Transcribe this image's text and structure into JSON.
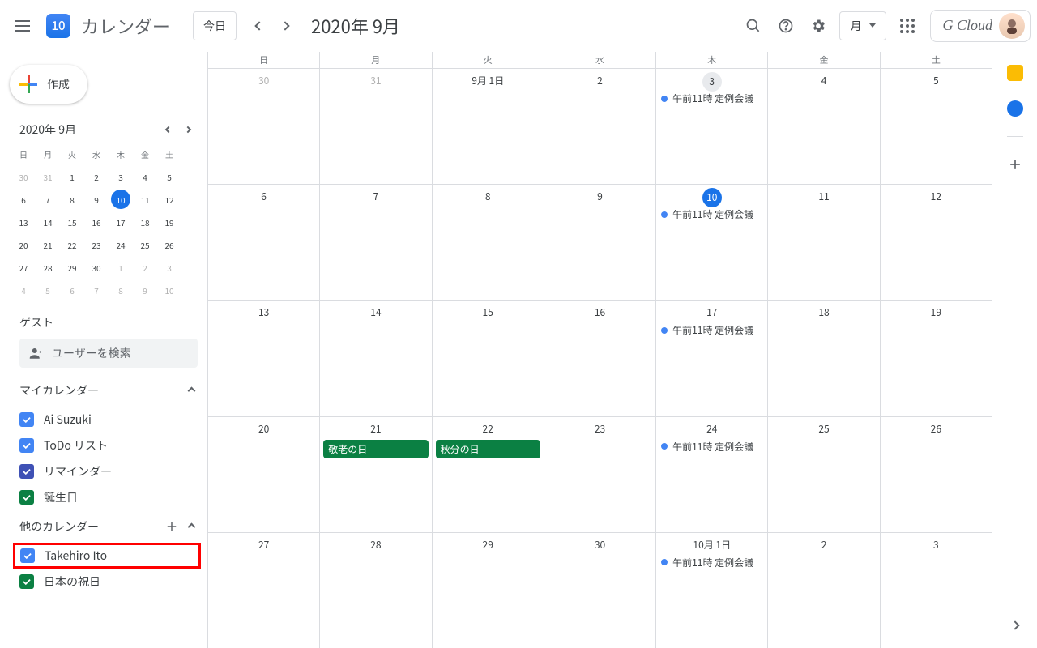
{
  "header": {
    "app_title": "カレンダー",
    "logo_day": "10",
    "today_btn": "今日",
    "date_title": "2020年 9月",
    "view_label": "月",
    "brand": "G Cloud"
  },
  "sidebar": {
    "create": "作成",
    "mini_title": "2020年 9月",
    "dow": [
      "日",
      "月",
      "火",
      "水",
      "木",
      "金",
      "土"
    ],
    "weeks": [
      [
        {
          "n": "30",
          "dim": true
        },
        {
          "n": "31",
          "dim": true
        },
        {
          "n": "1"
        },
        {
          "n": "2"
        },
        {
          "n": "3"
        },
        {
          "n": "4"
        },
        {
          "n": "5"
        }
      ],
      [
        {
          "n": "6"
        },
        {
          "n": "7"
        },
        {
          "n": "8"
        },
        {
          "n": "9"
        },
        {
          "n": "10",
          "today": true
        },
        {
          "n": "11"
        },
        {
          "n": "12"
        }
      ],
      [
        {
          "n": "13"
        },
        {
          "n": "14"
        },
        {
          "n": "15"
        },
        {
          "n": "16"
        },
        {
          "n": "17"
        },
        {
          "n": "18"
        },
        {
          "n": "19"
        }
      ],
      [
        {
          "n": "20"
        },
        {
          "n": "21"
        },
        {
          "n": "22"
        },
        {
          "n": "23"
        },
        {
          "n": "24"
        },
        {
          "n": "25"
        },
        {
          "n": "26"
        }
      ],
      [
        {
          "n": "27"
        },
        {
          "n": "28"
        },
        {
          "n": "29"
        },
        {
          "n": "30"
        },
        {
          "n": "1",
          "dim": true
        },
        {
          "n": "2",
          "dim": true
        },
        {
          "n": "3",
          "dim": true
        }
      ],
      [
        {
          "n": "4",
          "dim": true
        },
        {
          "n": "5",
          "dim": true
        },
        {
          "n": "6",
          "dim": true
        },
        {
          "n": "7",
          "dim": true
        },
        {
          "n": "8",
          "dim": true
        },
        {
          "n": "9",
          "dim": true
        },
        {
          "n": "10",
          "dim": true
        }
      ]
    ],
    "guest_label": "ゲスト",
    "search_placeholder": "ユーザーを検索",
    "my_cal": "マイカレンダー",
    "other_cal": "他のカレンダー",
    "my_items": [
      {
        "label": "Ai Suzuki",
        "color": "#4285f4"
      },
      {
        "label": "ToDo リスト",
        "color": "#4285f4"
      },
      {
        "label": "リマインダー",
        "color": "#3f51b5"
      },
      {
        "label": "誕生日",
        "color": "#0b8043"
      }
    ],
    "other_items": [
      {
        "label": "Takehiro Ito",
        "color": "#4285f4",
        "hl": true
      },
      {
        "label": "日本の祝日",
        "color": "#0b8043"
      }
    ]
  },
  "grid": {
    "dow": [
      "日",
      "月",
      "火",
      "水",
      "木",
      "金",
      "土"
    ],
    "weeks": [
      [
        {
          "n": "30",
          "dim": true
        },
        {
          "n": "31",
          "dim": true
        },
        {
          "n": "9月 1日"
        },
        {
          "n": "2"
        },
        {
          "n": "3",
          "past": true,
          "ev": [
            {
              "time": "午前11時",
              "title": "定例会議",
              "color": "#4285f4"
            }
          ]
        },
        {
          "n": "4"
        },
        {
          "n": "5"
        }
      ],
      [
        {
          "n": "6"
        },
        {
          "n": "7"
        },
        {
          "n": "8"
        },
        {
          "n": "9"
        },
        {
          "n": "10",
          "today": true,
          "ev": [
            {
              "time": "午前11時",
              "title": "定例会議",
              "color": "#4285f4"
            }
          ]
        },
        {
          "n": "11"
        },
        {
          "n": "12"
        }
      ],
      [
        {
          "n": "13"
        },
        {
          "n": "14"
        },
        {
          "n": "15"
        },
        {
          "n": "16"
        },
        {
          "n": "17",
          "ev": [
            {
              "time": "午前11時",
              "title": "定例会議",
              "color": "#4285f4"
            }
          ]
        },
        {
          "n": "18"
        },
        {
          "n": "19"
        }
      ],
      [
        {
          "n": "20"
        },
        {
          "n": "21",
          "hol": "敬老の日"
        },
        {
          "n": "22",
          "hol": "秋分の日"
        },
        {
          "n": "23"
        },
        {
          "n": "24",
          "ev": [
            {
              "time": "午前11時",
              "title": "定例会議",
              "color": "#4285f4"
            }
          ]
        },
        {
          "n": "25"
        },
        {
          "n": "26"
        }
      ],
      [
        {
          "n": "27"
        },
        {
          "n": "28"
        },
        {
          "n": "29"
        },
        {
          "n": "30"
        },
        {
          "n": "10月 1日",
          "ev": [
            {
              "time": "午前11時",
              "title": "定例会議",
              "color": "#4285f4"
            }
          ]
        },
        {
          "n": "2"
        },
        {
          "n": "3"
        }
      ]
    ]
  }
}
